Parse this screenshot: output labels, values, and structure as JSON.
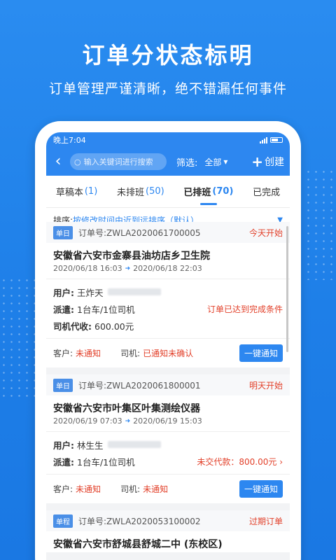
{
  "promo": {
    "headline": "订单分状态标明",
    "subline": "订单管理严谨清晰，绝不错漏任何事件"
  },
  "status_bar": {
    "time": "晚上7:04"
  },
  "nav": {
    "back_icon": "chevron-left-icon",
    "search_placeholder": "输入关键词进行搜索",
    "filter_label": "筛选:",
    "filter_value": "全部",
    "create_label": "创建"
  },
  "tabs": [
    {
      "label": "草稿本",
      "count": "(1)"
    },
    {
      "label": "未排班",
      "count": "(50)"
    },
    {
      "label": "已排班",
      "count": "(70)",
      "active": true
    },
    {
      "label": "已完成",
      "count": ""
    }
  ],
  "sort": {
    "label": "排序:",
    "value": "按修改时间由近到远排序（默认）"
  },
  "orders": [
    {
      "tag": "单日",
      "order_no": "订单号:ZWLA2020061700005",
      "state": "今天开始",
      "address": "安徽省六安市金寨县油坊店乡卫生院",
      "start": "2020/06/18 16:03",
      "end": "2020/06/18 22:03",
      "user_label": "用户:",
      "user_name": "王炸天",
      "dispatch_label": "派遣:",
      "dispatch": "1台车/1位司机",
      "dispatch_note": "订单已达到完成条件",
      "driver_fee_label": "司机代收:",
      "driver_fee": "600.00元",
      "customer_label": "客户:",
      "customer_status": "未通知",
      "driver_label": "司机:",
      "driver_status": "已通知未确认",
      "notify_label": "一键通知"
    },
    {
      "tag": "单日",
      "order_no": "订单号:ZWLA2020061800001",
      "state": "明天开始",
      "address": "安徽省六安市叶集区叶集测绘仪器",
      "start": "2020/06/19 07:03",
      "end": "2020/06/19 15:03",
      "user_label": "用户:",
      "user_name": "林生生",
      "dispatch_label": "派遣:",
      "dispatch": "1台车/1位司机",
      "dispatch_note": "未交代款：800.00元",
      "customer_label": "客户:",
      "customer_status": "未通知",
      "driver_label": "司机:",
      "driver_status": "未通知",
      "notify_label": "一键通知"
    },
    {
      "tag": "单程",
      "order_no": "订单号:ZWLA2020053100002",
      "state": "过期订单",
      "address": "安徽省六安市舒城县舒城二中 (东校区)"
    }
  ]
}
